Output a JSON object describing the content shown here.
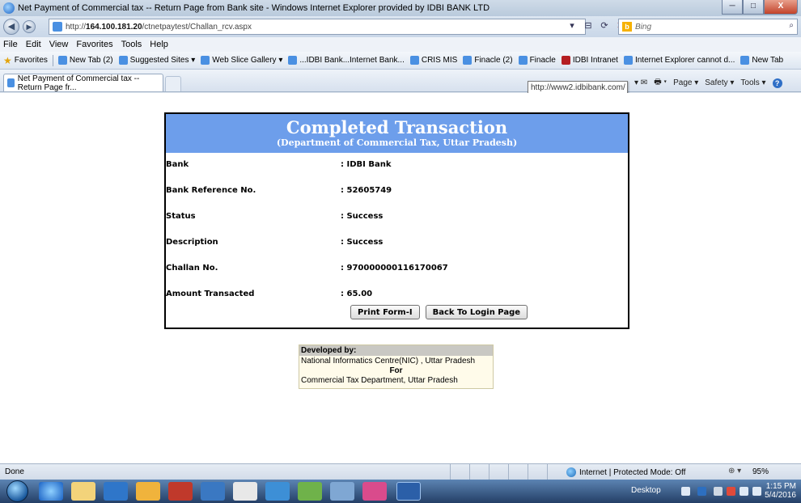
{
  "window": {
    "title": "Net Payment of Commercial tax -- Return Page from Bank site - Windows Internet Explorer provided by IDBI BANK LTD",
    "min_label": "─",
    "max_label": "□",
    "close_label": "X"
  },
  "address": {
    "prefix": "http://",
    "host": "164.100.181.20",
    "path": "/ctnetpaytest/Challan_rcv.aspx",
    "search_placeholder": "Bing"
  },
  "menu": [
    "File",
    "Edit",
    "View",
    "Favorites",
    "Tools",
    "Help"
  ],
  "favorites": {
    "label": "Favorites",
    "items": [
      "New Tab (2)",
      "Suggested Sites ▾",
      "Web Slice Gallery ▾",
      "...IDBI Bank...Internet Bank...",
      "CRIS MIS",
      "Finacle (2)",
      "Finacle",
      "IDBI Intranet",
      "Internet Explorer cannot d...",
      "New Tab"
    ]
  },
  "tab": {
    "label": "Net Payment of Commercial tax -- Return Page fr...",
    "tooltip": "http://www2.idbibank.com/"
  },
  "commandbar": {
    "page": "Page ▾",
    "safety": "Safety ▾",
    "tools": "Tools ▾"
  },
  "page": {
    "heading": "Completed Transaction",
    "subheading": "(Department of Commercial Tax, Uttar Pradesh)",
    "rows": [
      {
        "label": "Bank",
        "value": ": IDBI Bank"
      },
      {
        "label": "Bank Reference No.",
        "value": ": 52605749"
      },
      {
        "label": "Status",
        "value": ": Success"
      },
      {
        "label": "Description",
        "value": ": Success"
      },
      {
        "label": "Challan No.",
        "value": ": 970000000116170067"
      },
      {
        "label": "Amount Transacted",
        "value": ": 65.00"
      }
    ],
    "print_button": "Print Form-I",
    "back_button": "Back To Login Page",
    "developed_by": {
      "header": "Developed by:",
      "line1": "National Informatics Centre(NIC) , Uttar Pradesh",
      "for": "For",
      "line2": "Commercial Tax Department, Uttar Pradesh"
    }
  },
  "status": {
    "text": "Done",
    "zone": "Internet | Protected Mode: Off",
    "zoom": "95%"
  },
  "taskbar": {
    "desktop": "Desktop",
    "time": "1:15 PM",
    "date": "5/4/2016"
  },
  "colors": {
    "header_blue": "#6d9eeb"
  }
}
